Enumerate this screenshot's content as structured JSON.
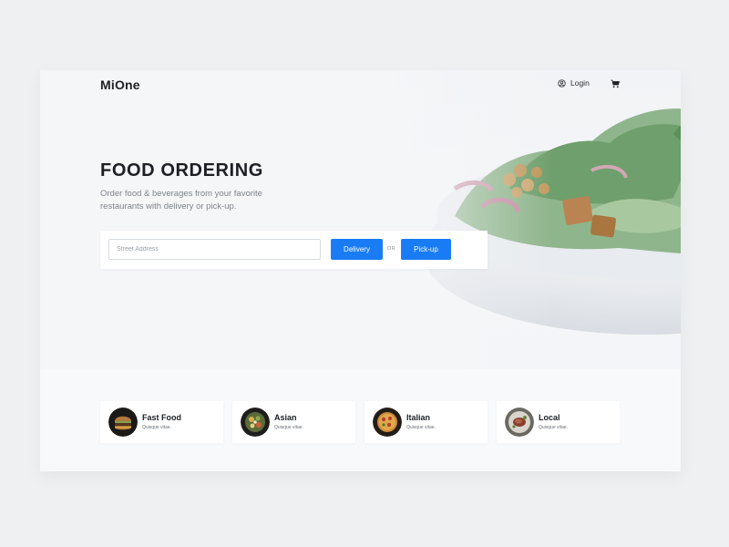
{
  "brand": "MiOne",
  "header": {
    "login_label": "Login",
    "login_icon": "user-circle-icon",
    "cart_icon": "cart-icon"
  },
  "hero": {
    "title": "FOOD ORDERING",
    "subtitle": "Order food & beverages from your favorite restaurants with delivery or pick-up.",
    "search": {
      "placeholder": "Street Address",
      "value": ""
    },
    "delivery_label": "Delivery",
    "or_label": "OR",
    "pickup_label": "Pick-up"
  },
  "categories": [
    {
      "name": "Fast Food",
      "desc": "Quisque vitae.",
      "image": "burger-image"
    },
    {
      "name": "Asian",
      "desc": "Quisque vitae.",
      "image": "asian-bowl-image"
    },
    {
      "name": "Italian",
      "desc": "Quisque vitae.",
      "image": "pizza-image"
    },
    {
      "name": "Local",
      "desc": "Quisque vitae.",
      "image": "steak-plate-image"
    }
  ],
  "colors": {
    "accent": "#1a7cf5",
    "page_bg": "#eef0f2",
    "title": "#1c1f23"
  }
}
